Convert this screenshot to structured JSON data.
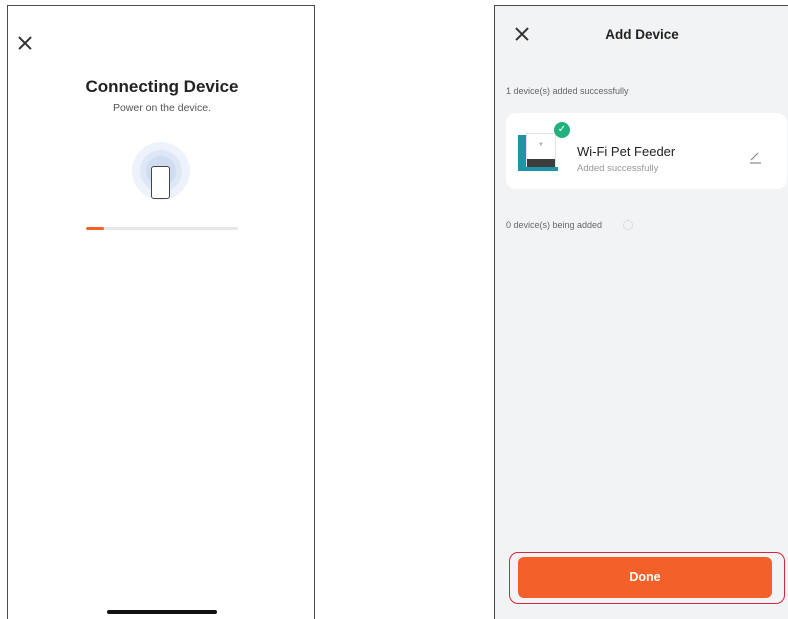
{
  "left_screen": {
    "title": "Connecting Device",
    "subtitle": "Power on the device.",
    "progress_fraction": 0.12,
    "accent_color": "#f4602a",
    "icons": {
      "close": "close-icon",
      "phone": "phone-icon"
    }
  },
  "right_screen": {
    "title": "Add Device",
    "added_count_label": "1 device(s) added successfully",
    "device": {
      "name": "Wi-Fi Pet Feeder",
      "status": "Added successfully",
      "icons": [
        "pet-feeder-image",
        "check-icon",
        "edit-icon"
      ]
    },
    "adding_count_label": "0 device(s) being added",
    "done_button": "Done",
    "button_color": "#f4602a",
    "highlight_color": "#d7263d",
    "success_color": "#22b07d",
    "icons": {
      "close": "close-icon",
      "spinner": "spinner-icon"
    }
  }
}
